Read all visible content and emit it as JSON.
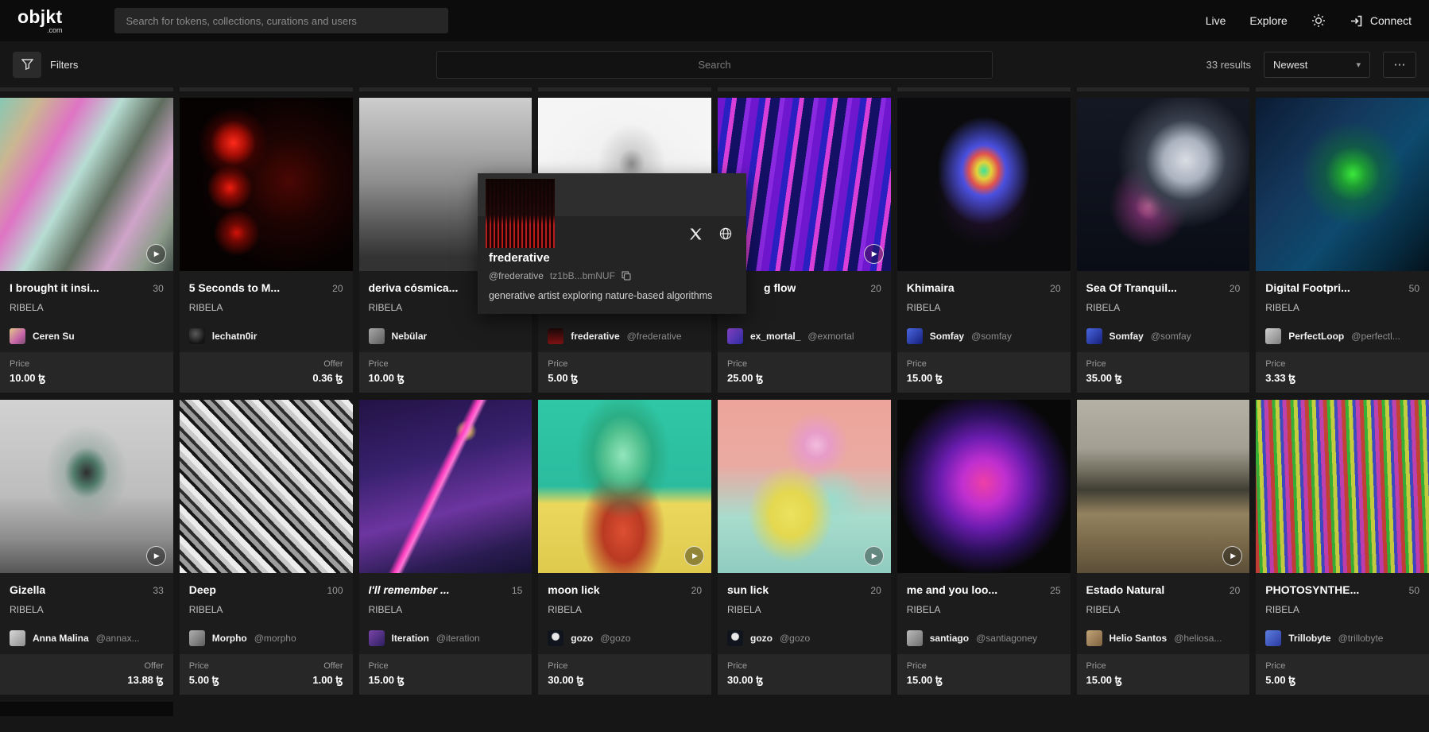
{
  "currency": "ꜩ",
  "header": {
    "logo": "objkt",
    "logo_suffix": ".com",
    "search_placeholder": "Search for tokens, collections, curations and users",
    "live": "Live",
    "explore": "Explore",
    "connect": "Connect"
  },
  "toolbar": {
    "filters": "Filters",
    "search_placeholder": "Search",
    "results": "33 results",
    "sort": "Newest",
    "chevron": "▾",
    "more": "⋯"
  },
  "profile": {
    "name": "frederative",
    "handle": "@frederative",
    "address": "tz1bB...bmNUF",
    "bio": "generative artist exploring nature-based algorithms",
    "avatar_art": "linear-gradient(180deg,rgba(14,4,4,0.97) 0%,rgba(22,6,6,0.9) 52%,rgba(22,6,6,0) 66%),repeating-linear-gradient(90deg,#b81d1d 0 2px,#200404 2px 5px)",
    "banner_color": "#2e2e2e"
  },
  "cards": [
    {
      "title": "I brought it insi...",
      "editions": "30",
      "collection": "RIBELA",
      "artist": {
        "name": "Ceren Su",
        "handle": ""
      },
      "play": true,
      "prices": [
        {
          "label": "Price",
          "value": "10.00",
          "align": "left"
        }
      ],
      "art": "linear-gradient(120deg,#86c9b4 0%,#cbb691 15%,#df74c4 30%,#b7ddd3 45%,#5f6d5e 60%,#cfa4c9 75%,#8e9c8c 88%,#43504a 100%)",
      "avatar": "linear-gradient(135deg,#e3c78a,#c563a8 60%,#7a4a6e)"
    },
    {
      "title": "5 Seconds to M...",
      "editions": "20",
      "collection": "RIBELA",
      "artist": {
        "name": "lechatn0ir",
        "handle": ""
      },
      "play": false,
      "prices": [
        {
          "label": "Offer",
          "value": "0.36",
          "align": "right"
        }
      ],
      "art": "radial-gradient(circle at 31% 26%,#ff2a1a 0%,#a80f06 7%,rgba(80,4,2,0.55) 13%,transparent 20%),radial-gradient(circle at 29% 52%,#ef1d10 0%,#8d0b04 6%,transparent 15%),radial-gradient(circle at 33% 78%,#d01208 0%,#700803 5%,transparent 13%),radial-gradient(circle at 63% 48%,#4a0703 0%,rgba(35,4,2,0.8) 30%,transparent 62%),#070202",
      "avatar": "radial-gradient(circle at 40% 35%,#5a5a5a,#141414 70%)"
    },
    {
      "title": "deriva cósmica...",
      "editions": "",
      "collection": "RIBELA",
      "artist": {
        "name": "Nebülar",
        "handle": ""
      },
      "play": false,
      "prices": [
        {
          "label": "Price",
          "value": "10.00",
          "align": "left"
        }
      ],
      "art": "linear-gradient(180deg,#cdcdcd 0%,#a9a9a9 30%,#8b8b8b 50%,#5f5f5f 70%,#333333 92%)",
      "avatar": "linear-gradient(135deg,#a8a8a8,#5c5c5c)"
    },
    {
      "title": "",
      "editions": "",
      "collection": "",
      "artist": {
        "name": "frederative",
        "handle": "@frederative"
      },
      "play": false,
      "prices": [
        {
          "label": "Price",
          "value": "5.00",
          "align": "left"
        }
      ],
      "art": "radial-gradient(ellipse at 54% 38%,rgba(60,60,60,0.55) 0%,rgba(120,120,120,0.25) 10%,transparent 26%),radial-gradient(ellipse at 50% 50%,#ededed 0%,#f5f5f5 70%)",
      "avatar": "linear-gradient(180deg,#1c0808,#7e1212)"
    },
    {
      "title": "g flow",
      "editions": "20",
      "collection": "",
      "indent": 46,
      "artist": {
        "name": "ex_mortal_",
        "handle": "@exmortal"
      },
      "play": true,
      "prices": [
        {
          "label": "Price",
          "value": "25.00",
          "align": "left"
        }
      ],
      "art": "repeating-linear-gradient(98deg,#6f17cf 0 10px,#2a1fc0 10px 18px,#d83fd8 18px 24px,#141066 24px 36px,#8a2ae0 36px 42px)",
      "avatar": "linear-gradient(135deg,#8a46cf,#2c2ba0)"
    },
    {
      "title": "Khimaira",
      "editions": "20",
      "collection": "RIBELA",
      "artist": {
        "name": "Somfay",
        "handle": "@somfay"
      },
      "play": false,
      "prices": [
        {
          "label": "Price",
          "value": "15.00",
          "align": "left"
        }
      ],
      "art": "radial-gradient(ellipse at 50% 42%,#39e39a 0%,#e3d23a 6%,#e05050 12%,#4a50e0 18%,rgba(10,10,10,0) 38%),radial-gradient(ellipse at 50% 55%,rgba(80,30,120,0.5) 0%,transparent 40%),#0b0b0d",
      "avatar": "linear-gradient(135deg,#4a66e0,#141f7a)"
    },
    {
      "title": "Sea Of Tranquil...",
      "editions": "20",
      "collection": "RIBELA",
      "artist": {
        "name": "Somfay",
        "handle": "@somfay"
      },
      "play": false,
      "prices": [
        {
          "label": "Price",
          "value": "35.00",
          "align": "left"
        }
      ],
      "art": "radial-gradient(circle at 63% 36%,#d9dde4 0%,#aab2bf 14%,#39404d 26%,transparent 44%),radial-gradient(ellipse at 42% 62%,#e368a8 0%,rgba(160,60,140,0.6) 10%,transparent 28%),linear-gradient(180deg,#141823 0%,#0a0d16 100%)",
      "avatar": "linear-gradient(135deg,#4a66e0,#141f7a)"
    },
    {
      "title": "Digital Footpri...",
      "editions": "50",
      "collection": "RIBELA",
      "artist": {
        "name": "PerfectLoop",
        "handle": "@perfectl..."
      },
      "play": false,
      "prices": [
        {
          "label": "Price",
          "value": "3.33",
          "align": "left"
        }
      ],
      "art": "radial-gradient(circle at 56% 44%,#3ae83a 0%,#1f9e33 9%,rgba(18,110,50,0.55) 20%,transparent 38%),linear-gradient(130deg,#0b1b33 0%,#14385c 35%,#0d4a6e 60%,#06293d 85%,#04121c 100%)",
      "avatar": "linear-gradient(135deg,#d0d0d0,#7e7e7e)"
    },
    {
      "title": "Gizella",
      "editions": "33",
      "collection": "RIBELA",
      "artist": {
        "name": "Anna Malina",
        "handle": "@annax..."
      },
      "play": true,
      "prices": [
        {
          "label": "Offer",
          "value": "13.88",
          "align": "right"
        }
      ],
      "art": "radial-gradient(ellipse at 50% 42%,#2e2e2e 0%,#4f7a6a 10%,rgba(120,150,140,0.4) 18%,transparent 34%),linear-gradient(180deg,#d2d2d2 0%,#bdbdbd 55%,#8d8d8d 80%,#565656 100%)",
      "avatar": "linear-gradient(135deg,#d8d8d8,#8e8e8e)"
    },
    {
      "title": "Deep",
      "editions": "100",
      "collection": "RIBELA",
      "artist": {
        "name": "Morpho",
        "handle": "@morpho"
      },
      "play": false,
      "prices": [
        {
          "label": "Price",
          "value": "5.00",
          "align": "left"
        },
        {
          "label": "Offer",
          "value": "1.00",
          "align": "right"
        }
      ],
      "art": "repeating-linear-gradient(46deg,#ececec 0 7px,#161616 7px 11px,#9d9d9d 11px 17px,#2c2c2c 17px 21px,#c9c9c9 21px 27px)",
      "avatar": "linear-gradient(135deg,#b0b0b0,#5e5e5e)"
    },
    {
      "title": "I'll remember ...",
      "editions": "15",
      "collection": "RIBELA",
      "italic": true,
      "artist": {
        "name": "Iteration",
        "handle": "@iteration"
      },
      "play": false,
      "prices": [
        {
          "label": "Price",
          "value": "15.00",
          "align": "left"
        }
      ],
      "art": "linear-gradient(116deg,transparent 44%,#ff3fc0 46.5%,#ff77d6 48%,transparent 50%),radial-gradient(circle at 62% 18%,#e8d9a8 0%,#caa85c 2.5%,transparent 6%),linear-gradient(165deg,#231245 0%,#38216e 35%,#6d35a0 62%,#2a1c52 85%,#171233 100%)",
      "avatar": "linear-gradient(135deg,#7a44a8,#2c1f60)"
    },
    {
      "title": "moon lick",
      "editions": "20",
      "collection": "RIBELA",
      "artist": {
        "name": "gozo",
        "handle": "@gozo"
      },
      "play": true,
      "prices": [
        {
          "label": "Price",
          "value": "30.00",
          "align": "left"
        }
      ],
      "art": "radial-gradient(ellipse at 49% 32%,#93e6bd 0%,#57c391 14%,rgba(40,150,100,0.5) 24%,transparent 38%),radial-gradient(ellipse at 49% 76%,#dd4f33 0%,#b93a22 16%,transparent 34%),linear-gradient(180deg,#2fc7a6 0%,#2bbc9e 50%,#ead75b 60%,#dfca4e 100%)",
      "avatar": "radial-gradient(circle at 50% 40%,#e8e8e8 0 28%,#10141c 34%)"
    },
    {
      "title": "sun lick",
      "editions": "20",
      "collection": "RIBELA",
      "artist": {
        "name": "gozo",
        "handle": "@gozo"
      },
      "play": true,
      "prices": [
        {
          "label": "Price",
          "value": "30.00",
          "align": "left"
        }
      ],
      "art": "radial-gradient(circle at 57% 26%,#f2bcdc 0%,#e79cc8 8%,transparent 20%),radial-gradient(ellipse at 42% 66%,#ece25e 0%,#e3d84f 14%,transparent 30%),radial-gradient(circle at 66% 58%,#9adccb 0%,transparent 22%),linear-gradient(180deg,#eda49a 0%,#eaaaa2 38%,#a8dccc 68%,#8fccbf 100%)",
      "avatar": "radial-gradient(circle at 50% 40%,#e8e8e8 0 28%,#10141c 34%)"
    },
    {
      "title": "me and you loo...",
      "editions": "25",
      "collection": "RIBELA",
      "artist": {
        "name": "santiago",
        "handle": "@santiagoney"
      },
      "play": false,
      "prices": [
        {
          "label": "Price",
          "value": "15.00",
          "align": "left"
        }
      ],
      "art": "radial-gradient(ellipse at 50% 48%,#ee3fa6 0%,#c02fd0 18%,#6a1cae 36%,#2a1058 54%,rgba(8,8,8,0.9) 72%),#070707",
      "avatar": "linear-gradient(135deg,#bcbcbc,#6e6e6e)"
    },
    {
      "title": "Estado Natural",
      "editions": "20",
      "collection": "RIBELA",
      "artist": {
        "name": "Helio Santos",
        "handle": "@heliosa..."
      },
      "play": true,
      "prices": [
        {
          "label": "Price",
          "value": "15.00",
          "align": "left"
        }
      ],
      "art": "linear-gradient(180deg,#b5b1a4 0%,#a39f92 28%,#6e6a5c 42%,#403e34 52%,#93825e 66%,#7a6a4a 82%,#5c4f38 100%)",
      "avatar": "linear-gradient(135deg,#c2a478,#7e6340)"
    },
    {
      "title": "PHOTOSYNTHE...",
      "editions": "50",
      "collection": "RIBELA",
      "artist": {
        "name": "Trillobyte",
        "handle": "@trillobyte"
      },
      "play": false,
      "prices": [
        {
          "label": "Price",
          "value": "5.00",
          "align": "left"
        }
      ],
      "art": "repeating-linear-gradient(88deg,rgba(224,60,60,0.85) 0 5px,rgba(60,190,60,0.85) 5px 9px,rgba(228,224,70,0.85) 9px 14px,rgba(70,70,220,0.85) 14px 18px,rgba(220,60,200,0.85) 18px 23px),linear-gradient(180deg,#146a14,#0c3a0c)",
      "avatar": "linear-gradient(135deg,#5c7ee0,#2c3aa0)"
    }
  ]
}
